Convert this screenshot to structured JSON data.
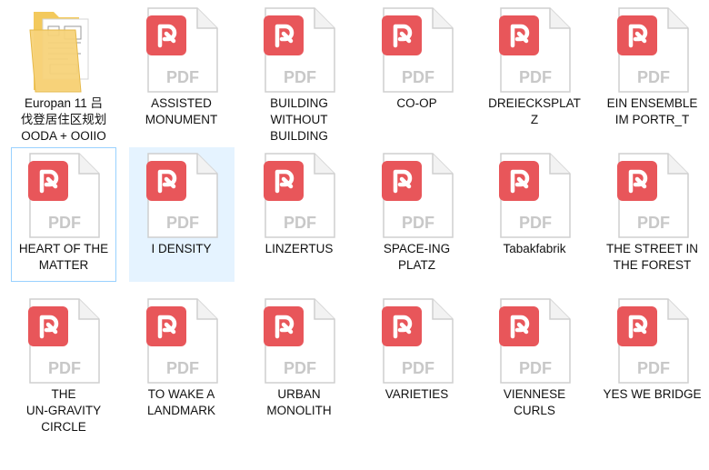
{
  "colors": {
    "pdf_badge": "#e8565a",
    "pdf_text": "#c8c8c8",
    "folder": "#f3c95c",
    "selection": "#e5f3ff",
    "focus_border": "#99d1ff"
  },
  "items": [
    {
      "label": "Europan 11 吕\n伐登居住区规划\nOODA + OOIIO",
      "type": "folder",
      "icon": "folder-icon"
    },
    {
      "label": "ASSISTED\nMONUMENT",
      "type": "pdf",
      "icon": "pdf-file-icon",
      "badge": "PDF"
    },
    {
      "label": "BUILDING\nWITHOUT\nBUILDING",
      "type": "pdf",
      "icon": "pdf-file-icon",
      "badge": "PDF"
    },
    {
      "label": "CO-OP",
      "type": "pdf",
      "icon": "pdf-file-icon",
      "badge": "PDF"
    },
    {
      "label": "DREIECKSPLATZ",
      "type": "pdf",
      "icon": "pdf-file-icon",
      "badge": "PDF"
    },
    {
      "label": "EIN ENSEMBLE\nIM PORTR_T",
      "type": "pdf",
      "icon": "pdf-file-icon",
      "badge": "PDF"
    },
    {
      "label": "HEART OF THE\nMATTER",
      "type": "pdf",
      "icon": "pdf-file-icon",
      "badge": "PDF",
      "state": "focused"
    },
    {
      "label": "I DENSITY",
      "type": "pdf",
      "icon": "pdf-file-icon",
      "badge": "PDF",
      "state": "selected"
    },
    {
      "label": "LINZERTUS",
      "type": "pdf",
      "icon": "pdf-file-icon",
      "badge": "PDF"
    },
    {
      "label": "SPACE-ING\nPLATZ",
      "type": "pdf",
      "icon": "pdf-file-icon",
      "badge": "PDF"
    },
    {
      "label": "Tabakfabrik",
      "type": "pdf",
      "icon": "pdf-file-icon",
      "badge": "PDF"
    },
    {
      "label": "THE STREET IN\nTHE FOREST",
      "type": "pdf",
      "icon": "pdf-file-icon",
      "badge": "PDF"
    },
    {
      "label": "THE\nUN-GRAVITY\nCIRCLE",
      "type": "pdf",
      "icon": "pdf-file-icon",
      "badge": "PDF"
    },
    {
      "label": "TO WAKE A\nLANDMARK",
      "type": "pdf",
      "icon": "pdf-file-icon",
      "badge": "PDF"
    },
    {
      "label": "URBAN\nMONOLITH",
      "type": "pdf",
      "icon": "pdf-file-icon",
      "badge": "PDF"
    },
    {
      "label": "VARIETIES",
      "type": "pdf",
      "icon": "pdf-file-icon",
      "badge": "PDF"
    },
    {
      "label": "VIENNESE\nCURLS",
      "type": "pdf",
      "icon": "pdf-file-icon",
      "badge": "PDF"
    },
    {
      "label": "YES WE BRIDGE",
      "type": "pdf",
      "icon": "pdf-file-icon",
      "badge": "PDF"
    }
  ]
}
